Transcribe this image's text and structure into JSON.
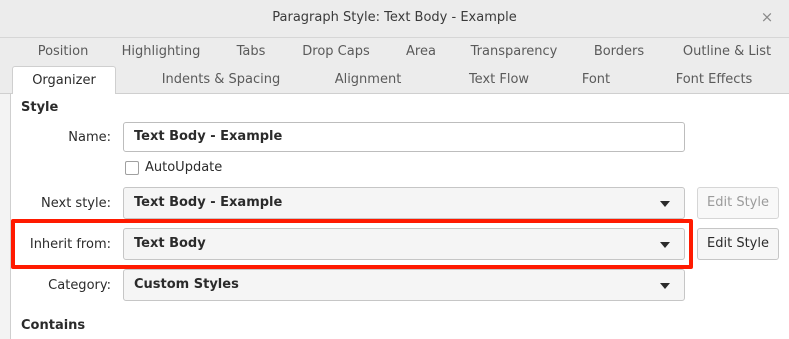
{
  "window": {
    "title": "Paragraph Style: Text Body - Example",
    "close_glyph": "×"
  },
  "tabs": {
    "row1": [
      "Position",
      "Highlighting",
      "Tabs",
      "Drop Caps",
      "Area",
      "Transparency",
      "Borders",
      "Outline & List"
    ],
    "row2": [
      "Organizer",
      "Indents & Spacing",
      "Alignment",
      "Text Flow",
      "Font",
      "Font Effects"
    ],
    "active": "Organizer"
  },
  "style_section": {
    "heading": "Style",
    "name_label": "Name:",
    "name_value": "Text Body - Example",
    "autoupdate_label": "AutoUpdate",
    "autoupdate_checked": false,
    "next_style_label": "Next style:",
    "next_style_value": "Text Body - Example",
    "next_edit_label": "Edit Style",
    "inherit_label": "Inherit from:",
    "inherit_value": "Text Body",
    "inherit_edit_label": "Edit Style",
    "category_label": "Category:",
    "category_value": "Custom Styles"
  },
  "contains_section": {
    "heading": "Contains"
  },
  "colors": {
    "highlight": "#ff1a00"
  }
}
